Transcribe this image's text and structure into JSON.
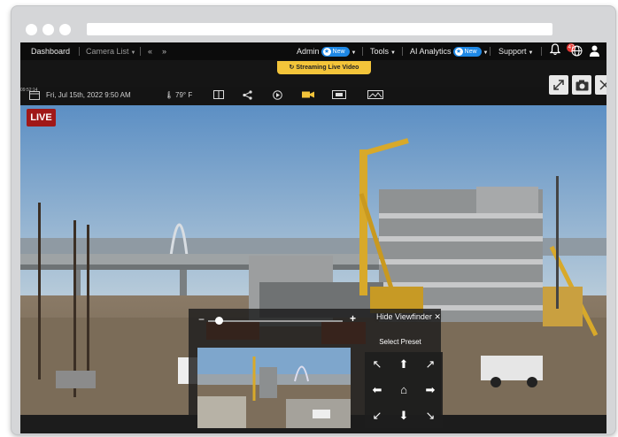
{
  "nav": {
    "dashboard": "Dashboard",
    "camera_list": "Camera List",
    "prev": "«",
    "next": "»",
    "admin": "Admin",
    "new_badge": "New",
    "tools": "Tools",
    "ai_analytics": "AI Analytics",
    "support": "Support",
    "notification_count": "47"
  },
  "streaming": {
    "label": "Streaming Live Video"
  },
  "info": {
    "timestamp_small": "09:52:14",
    "date": "Fri, Jul 15th, 2022 9:50 AM",
    "temperature": "79° F"
  },
  "live_badge": "LIVE",
  "viewfinder": {
    "minus": "−",
    "plus": "+",
    "hide_label": "Hide Viewfinder",
    "close": "✕",
    "preset_label": "Select Preset",
    "zoom_level": 0.05
  },
  "preset_arrows": {
    "up_left": "↖",
    "up": "⬆",
    "up_right": "↗",
    "left": "⬅",
    "home": "⌂",
    "right": "➡",
    "down_left": "↙",
    "down": "⬇",
    "down_right": "↘"
  },
  "colors": {
    "accent_yellow": "#f3c43a",
    "live_red": "#a01818",
    "badge_blue": "#1e88e5"
  }
}
